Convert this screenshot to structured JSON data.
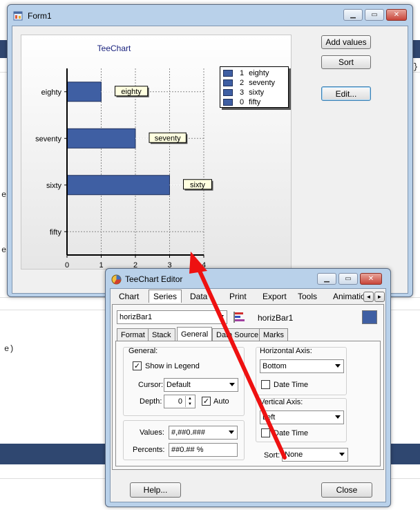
{
  "background": {
    "text_e1": "e",
    "text_e2": "e",
    "text_paren": "e)",
    "text_right": "}"
  },
  "form1": {
    "title": "Form1",
    "buttons": {
      "add_values": "Add values",
      "sort": "Sort",
      "edit": "Edit..."
    }
  },
  "chart": {
    "title": "TeeChart",
    "legend": [
      {
        "index": "1",
        "label": "eighty"
      },
      {
        "index": "2",
        "label": "seventy"
      },
      {
        "index": "3",
        "label": "sixty"
      },
      {
        "index": "0",
        "label": "fifty"
      }
    ],
    "bar_color": "#3f5fa3"
  },
  "chart_data": {
    "type": "bar",
    "orientation": "horizontal",
    "title": "TeeChart",
    "categories": [
      "eighty",
      "seventy",
      "sixty",
      "fifty"
    ],
    "values": [
      1,
      2,
      3,
      0
    ],
    "xlim": [
      0,
      4
    ],
    "xticks": [
      "0",
      "1",
      "2",
      "3",
      "4"
    ],
    "marks": [
      "eighty",
      "seventy",
      "sixty",
      ""
    ],
    "grid": true,
    "legend_position": "right"
  },
  "editor": {
    "title": "TeeChart Editor",
    "tabs": [
      "Chart",
      "Series",
      "Data",
      "Print",
      "Export",
      "Tools",
      "Animatio"
    ],
    "series_select": "horizBar1",
    "series_name": "horizBar1",
    "series_color": "#3f5fa3",
    "subtabs": [
      "Format",
      "Stack",
      "General",
      "Data Source",
      "Marks"
    ],
    "general": {
      "group_label": "General:",
      "show_in_legend": "Show in Legend",
      "cursor_label": "Cursor:",
      "cursor_value": "Default",
      "depth_label": "Depth:",
      "depth_value": "0",
      "auto_label": "Auto",
      "values_label": "Values:",
      "values_value": "#,##0.###",
      "percents_label": "Percents:",
      "percents_value": "##0.## %"
    },
    "horizontal_axis": {
      "label": "Horizontal Axis:",
      "value": "Bottom",
      "date_time": "Date Time"
    },
    "vertical_axis": {
      "label": "Vertical Axis:",
      "value": "Left",
      "date_time": "Date Time"
    },
    "sort": {
      "label": "Sort:",
      "value": "None"
    },
    "help_button": "Help...",
    "close_button": "Close"
  },
  "annotation": {
    "arrow_color": "#ee1111"
  }
}
